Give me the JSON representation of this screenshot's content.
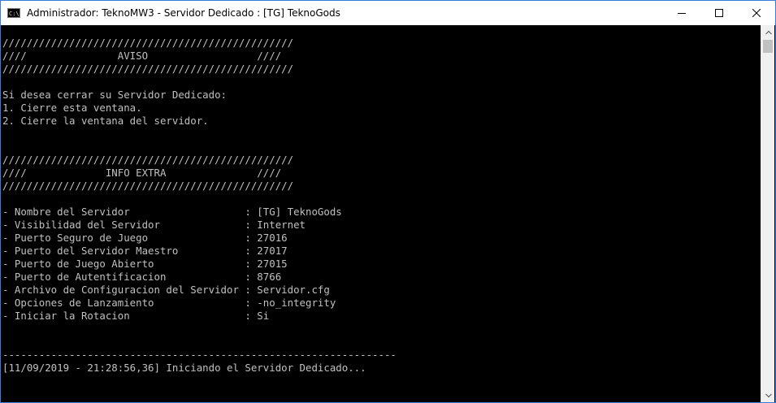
{
  "window": {
    "title": "Administrador:  TeknoMW3 - Servidor Dedicado : [TG] TeknoGods",
    "icon_label": "C:\\."
  },
  "console": {
    "lines": [
      "////////////////////////////////////////////////",
      "////               AVISO                  ////",
      "////////////////////////////////////////////////",
      "",
      "Si desea cerrar su Servidor Dedicado:",
      "1. Cierre esta ventana.",
      "2. Cierre la ventana del servidor.",
      "",
      "",
      "////////////////////////////////////////////////",
      "////             INFO EXTRA               ////",
      "////////////////////////////////////////////////",
      "",
      "- Nombre del Servidor                   : [TG] TeknoGods",
      "- Visibilidad del Servidor              : Internet",
      "- Puerto Seguro de Juego                : 27016",
      "- Puerto del Servidor Maestro           : 27017",
      "- Puerto de Juego Abierto               : 27015",
      "- Puerto de Autentificacion             : 8766",
      "- Archivo de Configuracion del Servidor : Servidor.cfg",
      "- Opciones de Lanzamiento               : -no_integrity",
      "- Iniciar la Rotacion                   : Si",
      "",
      "",
      "-----------------------------------------------------------------",
      "[11/09/2019 - 21:28:56,36] Iniciando el Servidor Dedicado..."
    ]
  },
  "icons": {
    "minimize": "minimize-icon",
    "maximize": "maximize-icon",
    "close": "close-icon",
    "scroll_up": "chevron-up-icon",
    "scroll_down": "chevron-down-icon"
  }
}
